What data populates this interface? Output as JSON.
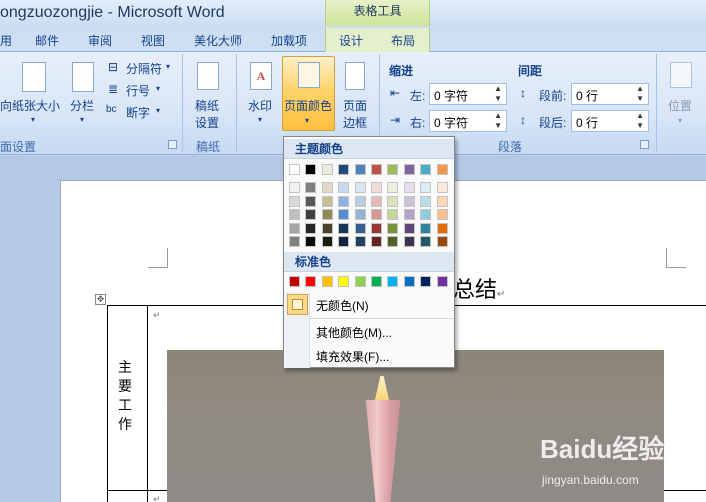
{
  "titlebar": {
    "title": "ongzuozongjie - Microsoft Word",
    "contextual_tools": "表格工具"
  },
  "tabs": [
    "用",
    "邮件",
    "审阅",
    "视图",
    "美化大师",
    "加载项",
    "设计",
    "布局"
  ],
  "ribbon": {
    "page_setup": {
      "label": "面设置",
      "size_left": "向",
      "paper_size": "纸张大小",
      "columns": "分栏",
      "breaks": "分隔符",
      "line_numbers": "行号",
      "hyphenation": "断字"
    },
    "manuscript": {
      "label": "稿纸",
      "button": [
        "稿纸",
        "设置"
      ]
    },
    "page_bg": {
      "watermark": "水印",
      "page_color": "页面颜色",
      "page_borders": [
        "页面",
        "边框"
      ]
    },
    "paragraph": {
      "label": "段落",
      "indent": {
        "title": "缩进",
        "left_label": "左:",
        "left_value": "0 字符",
        "right_label": "右:",
        "right_value": "0 字符"
      },
      "spacing": {
        "title": "间距",
        "before_label": "段前:",
        "before_value": "0 行",
        "after_label": "段后:",
        "after_value": "0 行"
      }
    },
    "arrange": {
      "position": "位置"
    }
  },
  "dropdown": {
    "theme_colors_title": "主题颜色",
    "standard_colors_title": "标准色",
    "no_color": "无颜色(N)",
    "more_colors": "其他颜色(M)...",
    "fill_effects": "填充效果(F)...",
    "theme_row": [
      "#ffffff",
      "#000000",
      "#eeece1",
      "#1f497d",
      "#4f81bd",
      "#c0504d",
      "#9bbb59",
      "#8064a2",
      "#4bacc6",
      "#f79646"
    ],
    "theme_shades": [
      [
        "#f2f2f2",
        "#7f7f7f",
        "#ddd9c3",
        "#c6d9f0",
        "#dbe5f1",
        "#f2dcdb",
        "#ebf1dd",
        "#e5e0ec",
        "#dbeef3",
        "#fdeada"
      ],
      [
        "#d8d8d8",
        "#595959",
        "#c4bd97",
        "#8db3e2",
        "#b8cce4",
        "#e5b9b7",
        "#d7e3bc",
        "#ccc1d9",
        "#b7dde8",
        "#fbd5b5"
      ],
      [
        "#bfbfbf",
        "#3f3f3f",
        "#938953",
        "#548dd4",
        "#95b3d7",
        "#d99694",
        "#c3d69b",
        "#b2a2c7",
        "#92cddc",
        "#fac08f"
      ],
      [
        "#a5a5a5",
        "#262626",
        "#494429",
        "#17365d",
        "#366092",
        "#953734",
        "#76923c",
        "#5f497a",
        "#31859b",
        "#e36c09"
      ],
      [
        "#7f7f7f",
        "#0c0c0c",
        "#1d1b10",
        "#0f243e",
        "#244061",
        "#632423",
        "#4f6128",
        "#3f3151",
        "#205867",
        "#974806"
      ]
    ],
    "standard_row": [
      "#c00000",
      "#ff0000",
      "#ffc000",
      "#ffff00",
      "#92d050",
      "#00b050",
      "#00b0f0",
      "#0070c0",
      "#002060",
      "#7030a0"
    ]
  },
  "document": {
    "heading_fragment": "总结",
    "cell_text": "主要工作"
  },
  "watermark": {
    "brand": "Baidu经验",
    "url": "jingyan.baidu.com"
  }
}
